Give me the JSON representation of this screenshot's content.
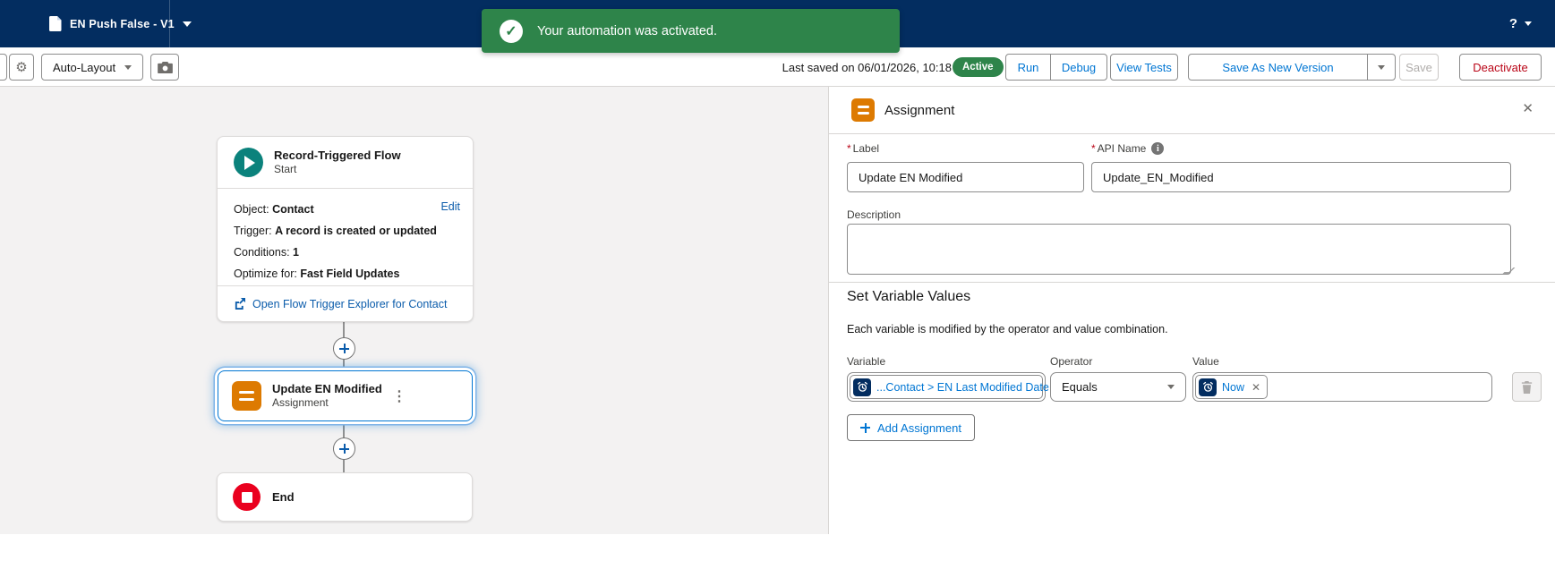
{
  "colors": {
    "header_navy": "#032d60",
    "accent_blue": "#0176d3",
    "link_blue": "#0b5cab",
    "success_green": "#2e844a",
    "assignment_orange": "#dd7a01",
    "start_teal": "#0b827c",
    "end_red": "#ea001e",
    "destructive_red": "#ba0517",
    "canvas_gray": "#f3f2f2"
  },
  "icons": {
    "gear": "⚙",
    "kebab": "⋮",
    "close": "✕",
    "remove": "✕",
    "check": "✓",
    "info": "i",
    "help": "?"
  },
  "header": {
    "flow_title": "EN Push False - V1"
  },
  "toast": {
    "message": "Your automation was activated."
  },
  "toolbar": {
    "layout_mode": "Auto-Layout",
    "last_saved": "Last saved on 06/01/2026, 10:18",
    "status": "Active",
    "run": "Run",
    "debug": "Debug",
    "view_tests": "View Tests",
    "save_as_new_version": "Save As New Version",
    "save": "Save",
    "deactivate": "Deactivate"
  },
  "canvas": {
    "start": {
      "title": "Record-Triggered Flow",
      "subtitle": "Start",
      "edit": "Edit",
      "rows": [
        {
          "label": "Object: ",
          "value": "Contact"
        },
        {
          "label": "Trigger: ",
          "value": "A record is created or updated"
        },
        {
          "label": "Conditions: ",
          "value": "1"
        },
        {
          "label": "Optimize for: ",
          "value": "Fast Field Updates"
        }
      ],
      "explorer_link": "Open Flow Trigger Explorer for Contact"
    },
    "assignment": {
      "title": "Update EN Modified",
      "subtitle": "Assignment"
    },
    "end": {
      "title": "End"
    }
  },
  "panel": {
    "title": "Assignment",
    "required_marker": "*",
    "label_field": {
      "label": "Label",
      "value": "Update EN Modified"
    },
    "api_name_field": {
      "label": "API Name",
      "value": "Update_EN_Modified"
    },
    "description_field": {
      "label": "Description",
      "value": ""
    },
    "set_values": {
      "heading": "Set Variable Values",
      "help_text": "Each variable is modified by the operator and value combination.",
      "variable_label": "Variable",
      "operator_label": "Operator",
      "value_label": "Value",
      "variable_pill": "...Contact > EN Last Modified Date",
      "operator": "Equals",
      "value_pill": "Now",
      "add_button": "Add Assignment"
    }
  }
}
